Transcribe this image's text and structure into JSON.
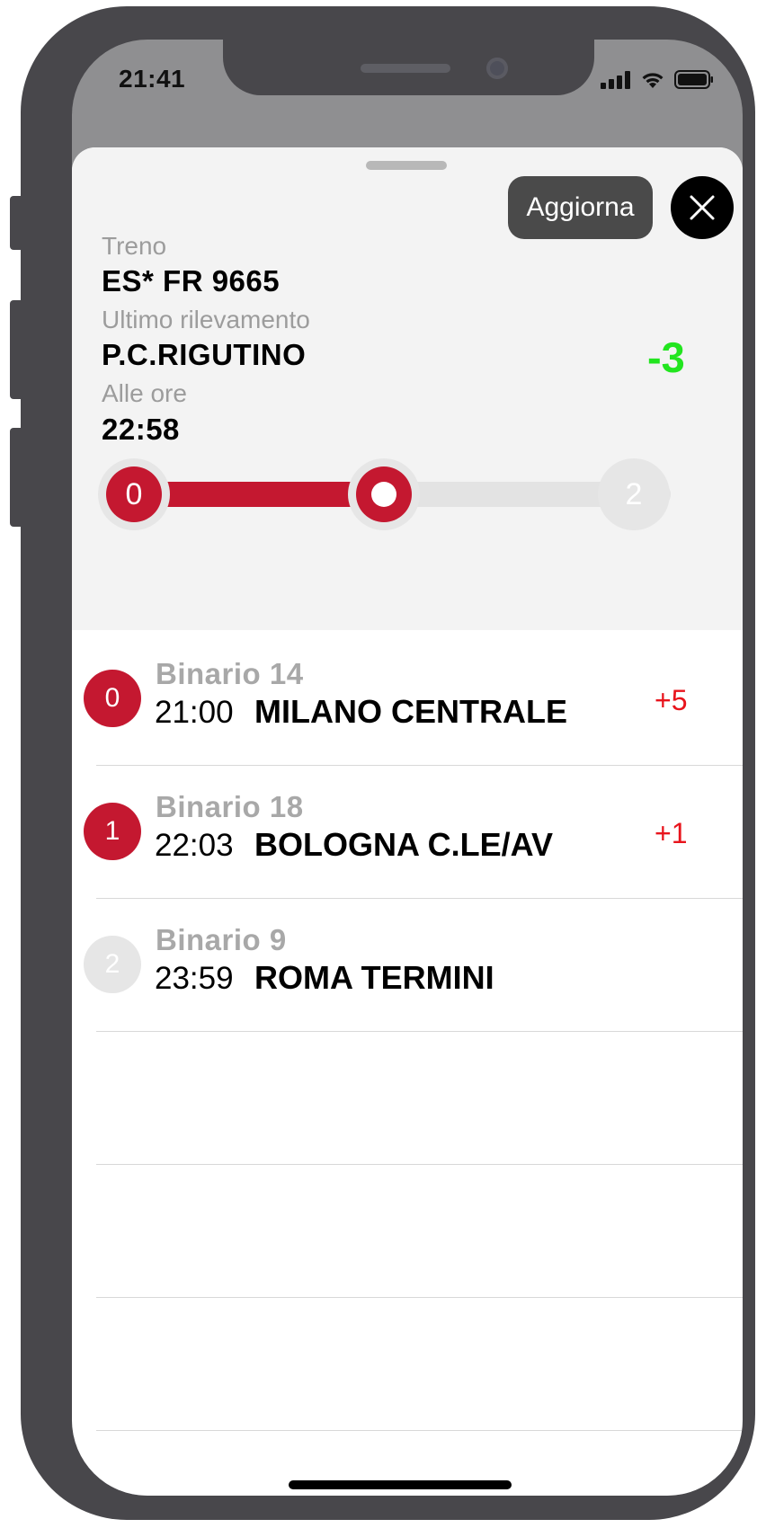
{
  "status_bar": {
    "time": "21:41"
  },
  "header": {
    "refresh_label": "Aggiorna",
    "train_label": "Treno",
    "train_value": "ES* FR 9665",
    "last_detection_label": "Ultimo rilevamento",
    "last_detection_value": "P.C.RIGUTINO",
    "at_time_label": "Alle ore",
    "at_time_value": "22:58",
    "delay": "-3",
    "delay_color": "#22e51f"
  },
  "progress": {
    "start_label": "0",
    "end_label": "2",
    "fraction": 0.5
  },
  "stops": [
    {
      "index": "0",
      "platform": "Binario 14",
      "time": "21:00",
      "name": "MILANO CENTRALE",
      "delay": "+5",
      "status": "passed"
    },
    {
      "index": "1",
      "platform": "Binario 18",
      "time": "22:03",
      "name": "BOLOGNA C.LE/AV",
      "delay": "+1",
      "status": "passed"
    },
    {
      "index": "2",
      "platform": "Binario 9",
      "time": "23:59",
      "name": "ROMA TERMINI",
      "delay": "",
      "status": "upcoming"
    }
  ],
  "colors": {
    "accent": "#c41830",
    "delay_positive": "#e8141c",
    "button_dark": "#4a4a4a"
  }
}
